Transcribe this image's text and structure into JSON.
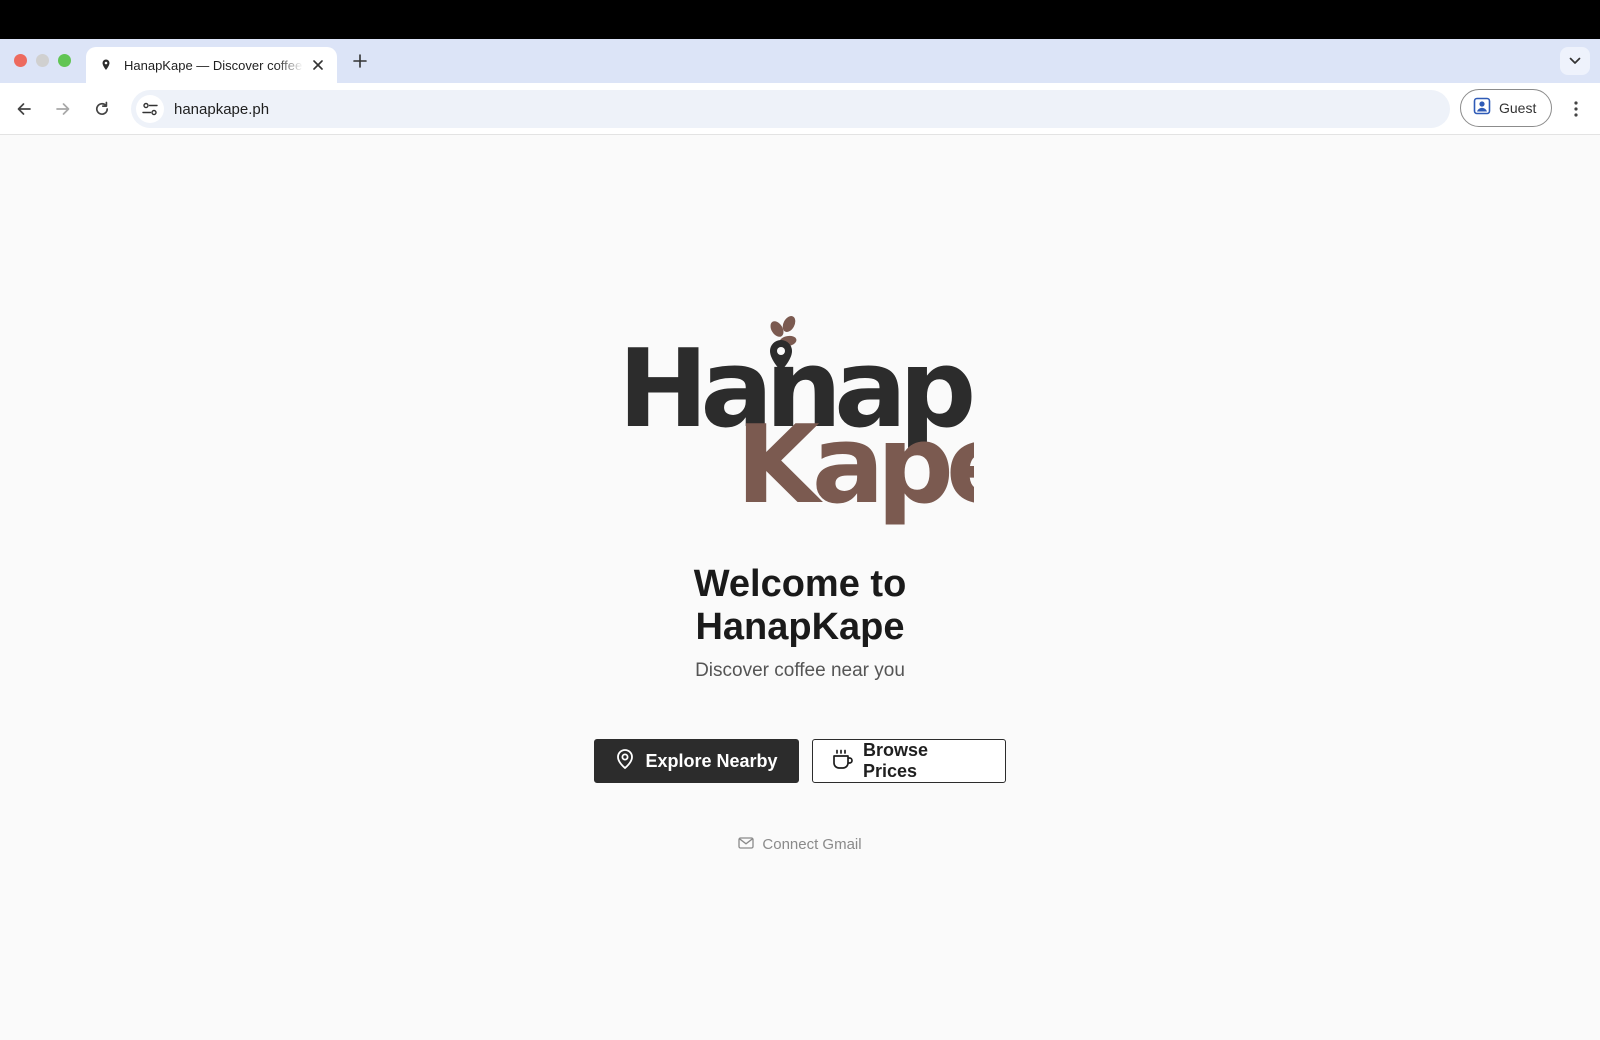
{
  "browser": {
    "tab": {
      "title": "HanapKape — Discover coffee near you"
    },
    "address_bar": {
      "url": "hanapkape.ph"
    },
    "profile": {
      "label": "Guest"
    }
  },
  "icons": {
    "favicon": "map-pin-icon",
    "tab_close": "close-icon",
    "new_tab": "plus-icon",
    "tab_search": "chevron-down-icon",
    "back": "arrow-left-icon",
    "forward": "arrow-right-icon",
    "reload": "reload-icon",
    "site_settings": "tune-icon",
    "profile": "person-badge-icon",
    "menu": "kebab-menu-icon",
    "explore": "map-pin-icon",
    "browse": "coffee-cup-icon",
    "gmail": "envelope-icon"
  },
  "logo": {
    "line1": "Hanap",
    "line2": "Kape",
    "colors": {
      "dark": "#2c2c2c",
      "brown": "#7b5a50"
    }
  },
  "hero": {
    "heading": "Welcome to HanapKape",
    "subheading": "Discover coffee near you"
  },
  "actions": {
    "explore_label": "Explore Nearby",
    "browse_label": "Browse Prices",
    "gmail_label": "Connect Gmail"
  },
  "colors": {
    "tab_strip": "#dce4f7",
    "page_bg": "#fafafa",
    "primary_button": "#2c2c2c",
    "muted_text": "#8a8a8a"
  }
}
